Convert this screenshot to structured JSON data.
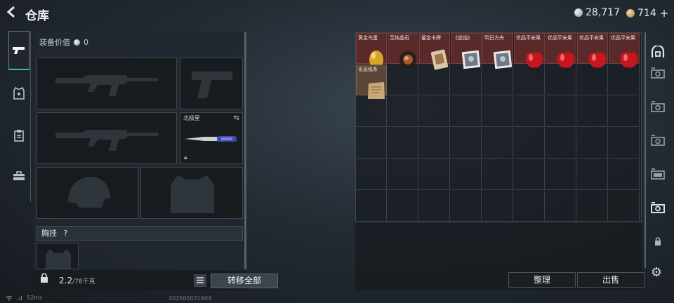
{
  "header": {
    "title": "仓库",
    "silver_amount": "28,717",
    "gold_amount": "714",
    "plus": "+"
  },
  "equipment": {
    "value_label": "装备价值",
    "value": "0",
    "knife_name": "北极星",
    "rig_label": "胸挂",
    "rig_help": "?"
  },
  "bottom_left": {
    "weight_current": "2.2",
    "weight_max": "/78千克",
    "transfer_all": "转移全部"
  },
  "storage": {
    "items": [
      {
        "name": "黄金鸟蛋",
        "icon": "golden-egg-icon",
        "style": "red"
      },
      {
        "name": "至纯晶石",
        "icon": "crystal-icon",
        "style": "red"
      },
      {
        "name": "鎏金卡牌",
        "icon": "card-icon",
        "style": "red"
      },
      {
        "name": "《逆战》",
        "icon": "poster-icon",
        "style": "red"
      },
      {
        "name": "明日方舟",
        "icon": "poster-icon",
        "style": "red"
      },
      {
        "name": "优品平安果",
        "icon": "apple-icon",
        "style": "red"
      },
      {
        "name": "优品平安果",
        "icon": "apple-icon",
        "style": "red"
      },
      {
        "name": "优品平安果",
        "icon": "apple-icon",
        "style": "red"
      },
      {
        "name": "优品平安果",
        "icon": "apple-icon",
        "style": "red"
      },
      {
        "name": "讯息纸条",
        "icon": "note-icon",
        "style": "brown"
      }
    ],
    "sort_label": "整理",
    "sell_label": "出售"
  },
  "footer": {
    "ping": "52ms",
    "build": "202606031904"
  },
  "colors": {
    "accent_green": "#37c48a",
    "item_red": "#5a2a2a",
    "item_brown": "#5b4737"
  }
}
